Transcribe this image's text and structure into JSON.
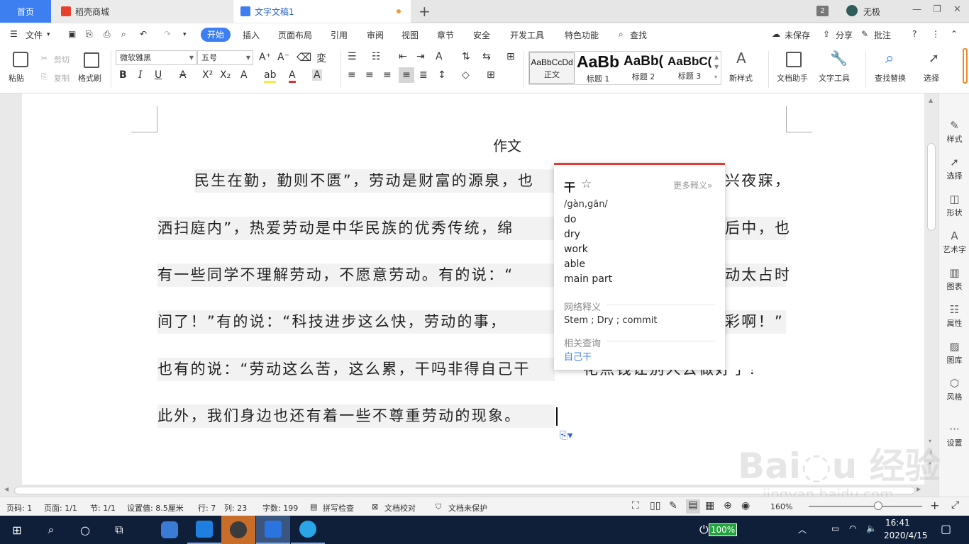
{
  "tabs": {
    "home": "首页",
    "store": "稻壳商城",
    "doc": "文字文稿1",
    "window_count": "2",
    "user": "无极"
  },
  "menu": {
    "file": "文件",
    "start": "开始",
    "insert": "插入",
    "layout": "页面布局",
    "ref": "引用",
    "review": "审阅",
    "view": "视图",
    "chapter": "章节",
    "security": "安全",
    "dev": "开发工具",
    "special": "特色功能",
    "search": "查找",
    "unsaved": "未保存",
    "share": "分享",
    "annotate": "批注"
  },
  "ribbon": {
    "paste": "粘贴",
    "cut": "剪切",
    "copy": "复制",
    "format_painter": "格式刷",
    "font": "微软雅黑",
    "size": "五号",
    "styles": [
      {
        "preview": "AaBbCcDd",
        "name": "正文"
      },
      {
        "preview": "AaBb",
        "name": "标题 1"
      },
      {
        "preview": "AaBb(",
        "name": "标题 2"
      },
      {
        "preview": "AaBbC(",
        "name": "标题 3"
      }
    ],
    "new_style": "新样式",
    "doc_helper": "文档助手",
    "text_tools": "文字工具",
    "find_replace": "查找替换",
    "select": "选择"
  },
  "document": {
    "title": "作文",
    "lines": [
      "民生在勤，勤则不匮”，劳动是财富的源泉，也",
      "洒扫庭内”，热爱劳动是中华民族的优秀传统，绵",
      "有一些同学不理解劳动，不愿意劳动。有的说：“",
      "间了！”有的说：“科技进步这么快，劳动的事，",
      "也有的说：“劳动这么苦，这么累，干吗非得自己干",
      "此外，我们身边也还有着一些不尊重劳动的现象。"
    ],
    "tails": [
      "兴夜寐，",
      "后中，也",
      "动太占时",
      "彩啊！”",
      "花点钱让别人去做好了！”"
    ]
  },
  "popup": {
    "word": "干",
    "more": "更多释义»",
    "phonetic": "/gàn,gān/",
    "defs": [
      "do",
      "dry",
      "work",
      "able",
      "main part"
    ],
    "net_label": "网络释义",
    "net": "Stem ; Dry ; commit",
    "related_label": "相关查询",
    "related": "自己干"
  },
  "right_panel": [
    "样式",
    "选择",
    "形状",
    "艺术字",
    "图表",
    "属性",
    "图库",
    "风格",
    "设置"
  ],
  "status": {
    "page": "页码: 1",
    "pages": "页面: 1/1",
    "section": "节: 1/1",
    "setting": "设置值: 8.5厘米",
    "row": "行: 7",
    "col": "列: 23",
    "words": "字数: 199",
    "spell": "拼写检查",
    "proof": "文档校对",
    "protect": "文档未保护",
    "zoom": "160%"
  },
  "taskbar": {
    "battery": "100%",
    "time": "16:41",
    "date": "2020/4/15"
  },
  "watermark": {
    "logo": "Bai 经验",
    "url": "jingyan.baidu.com"
  }
}
